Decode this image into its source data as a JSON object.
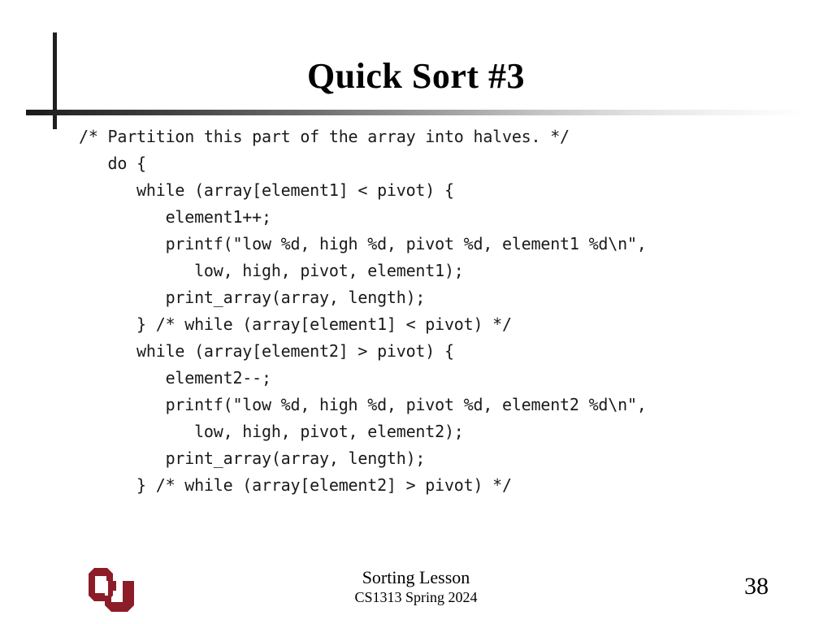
{
  "slide": {
    "title": "Quick Sort #3",
    "page_number": "38",
    "background_color": "#ffffff",
    "title_rule_color": "#1f1f1f"
  },
  "code": {
    "language": "C",
    "lines": [
      "/* Partition this part of the array into halves. */",
      "   do {",
      "      while (array[element1] < pivot) {",
      "         element1++;",
      "         printf(\"low %d, high %d, pivot %d, element1 %d\\n\",",
      "            low, high, pivot, element1);",
      "         print_array(array, length);",
      "      } /* while (array[element1] < pivot) */",
      "      while (array[element2] > pivot) {",
      "         element2--;",
      "         printf(\"low %d, high %d, pivot %d, element2 %d\\n\",",
      "            low, high, pivot, element2);",
      "         print_array(array, length);",
      "      } /* while (array[element2] > pivot) */"
    ]
  },
  "footer": {
    "lesson": "Sorting Lesson",
    "course": "CS1313 Spring 2024",
    "logo_alt": "OU",
    "logo_color": "#8C1D28"
  }
}
